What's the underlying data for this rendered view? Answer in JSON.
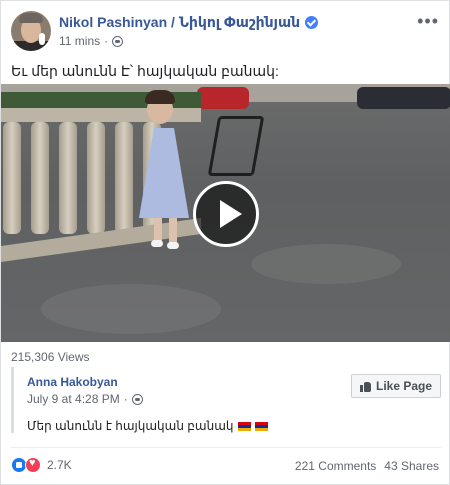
{
  "post": {
    "author": "Nikol Pashinyan / Նիկոլ Փաշինյան",
    "time": "11 mins",
    "more_icon": "more-horizontal-icon",
    "text": "Եւ մեր անունն Է՝ հայկական բանակ:"
  },
  "video": {
    "views": "215,306 Views",
    "play_icon": "play-icon"
  },
  "shared": {
    "author": "Anna Hakobyan",
    "date": "July 9 at 4:28 PM",
    "like_page_label": "Like Page",
    "text": "Մեր անունն է հայկական բանակ"
  },
  "footer": {
    "reaction_count": "2.7K",
    "comments": "221 Comments",
    "shares": "43 Shares"
  },
  "colors": {
    "link_blue": "#385898",
    "verified_blue": "#4080ff",
    "like_blue": "#1877f2",
    "love_red": "#f33e58"
  }
}
